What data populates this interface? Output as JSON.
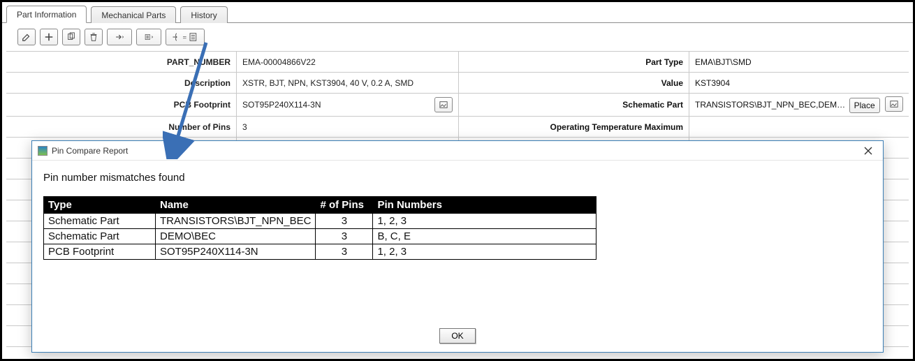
{
  "tabs": [
    {
      "label": "Part Information",
      "active": true
    },
    {
      "label": "Mechanical Parts",
      "active": false
    },
    {
      "label": "History",
      "active": false
    }
  ],
  "toolbar_icons": [
    "edit",
    "add",
    "copy",
    "delete",
    "next",
    "menu",
    "compare"
  ],
  "fields": {
    "part_number": {
      "label": "PART_NUMBER",
      "value": "EMA-00004866V22"
    },
    "part_type": {
      "label": "Part Type",
      "value": "EMA\\BJT\\SMD"
    },
    "description": {
      "label": "Description",
      "value": "XSTR, BJT, NPN, KST3904, 40 V, 0.2 A, SMD"
    },
    "valuefld": {
      "label": "Value",
      "value": "KST3904"
    },
    "pcb": {
      "label": "PCB Footprint",
      "value": "SOT95P240X114-3N"
    },
    "schpart": {
      "label": "Schematic Part",
      "value": "TRANSISTORS\\BJT_NPN_BEC,DEMO\\BEC",
      "place_btn": "Place"
    },
    "num_pins": {
      "label": "Number of Pins",
      "value": "3"
    },
    "op_temp": {
      "label": "Operating Temperature Maximum",
      "value": ""
    }
  },
  "dialog": {
    "title": "Pin Compare Report",
    "message": "Pin number mismatches found",
    "ok": "OK",
    "headers": [
      "Type",
      "Name",
      "# of Pins",
      "Pin Numbers"
    ],
    "rows": [
      {
        "type": "Schematic Part",
        "name": "TRANSISTORS\\BJT_NPN_BEC",
        "pins": "3",
        "pin_numbers": "1, 2, 3"
      },
      {
        "type": "Schematic Part",
        "name": "DEMO\\BEC",
        "pins": "3",
        "pin_numbers": "B, C, E"
      },
      {
        "type": "PCB Footprint",
        "name": "SOT95P240X114-3N",
        "pins": "3",
        "pin_numbers": "1, 2, 3"
      }
    ]
  },
  "arrow_color": "#3a6fb5"
}
